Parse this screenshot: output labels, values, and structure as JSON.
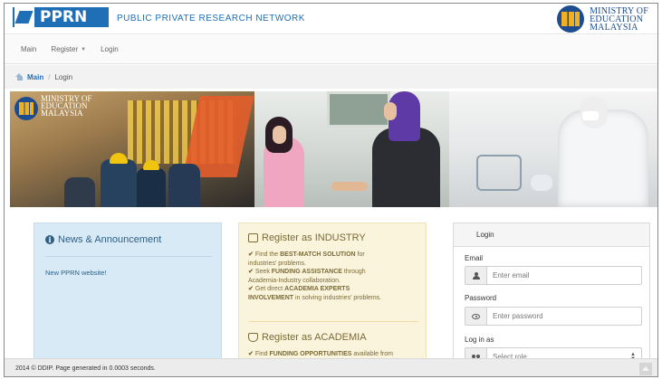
{
  "header": {
    "logo_text": "PPRN",
    "network_name": "PUBLIC PRIVATE RESEARCH NETWORK",
    "ministry_lines": [
      "MINISTRY OF",
      "EDUCATION",
      "MALAYSIA"
    ]
  },
  "nav": {
    "main": "Main",
    "register": "Register",
    "login": "Login"
  },
  "breadcrumb": {
    "main": "Main",
    "separator": "/",
    "current": "Login"
  },
  "banner": {
    "ministry_lines": [
      "MINISTRY OF",
      "EDUCATION",
      "MALAYSIA"
    ]
  },
  "news": {
    "title": "News & Announcement",
    "items": [
      "New PPRN website!"
    ]
  },
  "register_industry": {
    "title": "Register as INDUSTRY",
    "line1_pre": "Find the ",
    "line1_bold": "BEST-MATCH SOLUTION",
    "line1_post": " for",
    "line2": "industries' problems.",
    "line3_pre": "Seek ",
    "line3_bold": "FUNDING ASSISTANCE",
    "line3_post": " through",
    "line4": "Academia-Industry collaboration.",
    "line5_pre": "Get direct ",
    "line5_bold": "ACADEMIA EXPERTS",
    "line6_bold": "INVOLVEMENT",
    "line6_post": " in solving industries' problems."
  },
  "register_academia": {
    "title": "Register as ACADEMIA",
    "line1_pre": "Find ",
    "line1_bold": "FUNDING OPPORTUNITIES",
    "line1_post": " available from"
  },
  "login": {
    "heading": "Login",
    "email_label": "Email",
    "email_placeholder": "Enter email",
    "password_label": "Password",
    "password_placeholder": "Enter password",
    "role_label": "Log in as",
    "role_value": "Select role"
  },
  "footer": {
    "text": "2014 © DDIP. Page generated in 0.0003 seconds."
  },
  "colors": {
    "brand_blue": "#1f6fb7",
    "news_bg": "#d8eaf6",
    "register_bg": "#fbf4dc"
  },
  "icons": {
    "home": "home-icon",
    "info": "info-icon",
    "industry": "industry-icon",
    "academia": "academia-icon",
    "user": "user-icon",
    "eye": "eye-icon",
    "users": "users-icon"
  }
}
